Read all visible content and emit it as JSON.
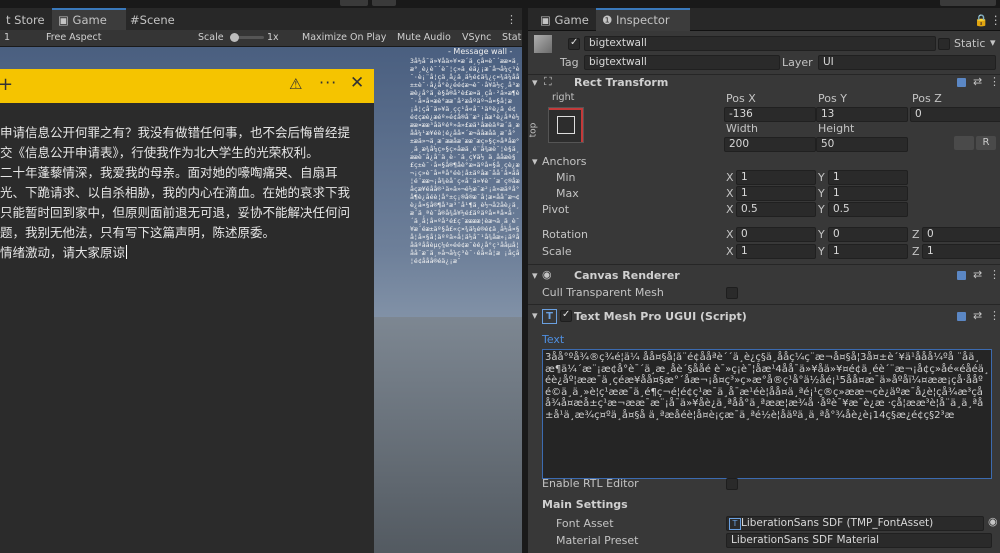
{
  "tabs_left": [
    {
      "label": "t Store",
      "active": false
    },
    {
      "label": "Game",
      "active": true
    },
    {
      "label": "Scene",
      "active": false
    }
  ],
  "tabs_right": [
    {
      "label": "Game",
      "active": false
    },
    {
      "label": "Inspector",
      "active": true
    }
  ],
  "game_toolbar": {
    "display": "1",
    "aspect": "Free Aspect",
    "scale_label": "Scale",
    "scale_value": "1x",
    "maximize": "Maximize On Play",
    "mute": "Mute Audio",
    "vsync": "VSync",
    "stats": "Stat"
  },
  "dialog": {
    "paragraphs": [
      "申请信息公开何罪之有？我没有做错任何事，也不会后悔曾经提交《信息公开申请表》，行使我作为北大学生的光荣权利。",
      "二十年蓬藜情深，我爱我的母亲。面对她的嚎啕痛哭、自扇耳光、下跪请求、以自杀相胁，我的内心在滴血。在她的哀求下我只能暂时回到家中，但原则面前退无可退，妥协不能解决任何问题，我别无他法，只有写下这篇声明，陈述原委。",
      "情绪激动，请大家原谅"
    ]
  },
  "wall": {
    "title": "- Message wall -",
    "text": "3å½å¯ä»¥åä»¥¤æ´ä¸çå¤è¯´ææ¤ä¸æ°¸è¿è¯´è¯¦ç»ä¸éä¿¡æ¯å¬å¼ç³è¯·è¡¨å­¦çä¸­å¿ä¸ä½é¢ä¾¿ç¤¾ä¼åå±±è¯·å¿å°è¿éé¢æ¬è¯·å¥ä½ç¸å³ææè¿å°ä¸è§å®å²è£æ­¤ä¸çå·²ä»æ¶è¯·å¤å¤æè°ææ¨å²æåºäº¬å¤§å­¦æ ¡å­¦çå¯ä»¥ä¸çç¹å«å¯¹äºè¿ä¸é¢é¢çæè¿æéº»é¢å®å¨æ²¡åæ³è¿åªè½ææ­¤ææ³åäºéº»ä»£æä¹åæèäºæ´ä¸æåå¼¹æ¥éè¦é¿åå¤´æ¬ååæåä¸æ¨å°±æä»¬ä¸æ¯ææåæ¨ææ¯æç»§ç»­åªåæ°¸ä¸æ¾å¼ç»§ç»­åæä¸é¨å¾æè¯¦è§ä¸ææè¯å¿å¨ä¸è·¯ä¸ç¥ä½ ä¸ååæè§£ç±è¯·å¤§å®¶åè°æ­¤äºå¤§å¸çè¿æ¬¡ç»è¯å¤ªå°éè¦å±äºåæ¯åå¨å¤åå¦é¨ææ¬¡å¾èå¨ç«å¯ä»¥è¯´æ¯ç®åæåçæ¥éåå®¹ä»ä»¬é½æ¯æ²¡ä»æäºå°å¶è¿åéè¦å°±ç¡®å®æ¯å¦æ­¤åå¨æ¬¢è¿å¤§å®¶å³æ³¨å¹¶ä¸è½¬å2åè¿ä¸æ´ä¸ªè¯å®å¾å¥½é£äºäºå¤ªå¤å·´ä¸­å­¦å¤ºå²é£ç¯ææææ¦èæ¬ä¸ä¸è¯¥æ´éæ±äº§å£«ç¤¾ä¼é®é¢ä¸­å½å¤§å¦å¤§å¦äººä»å¦ä½å¯¹å¾åæ»¡äºååäºååèµç¼é»éé¢æ¯èé¿å°ç¹ååµå¦åå¯æ¯ä¸»å¬å¼ç³è¯·éå«å­¦æ ¡åçå¦é¢ååå®éä¿¡æ¯"
  },
  "inspector": {
    "object_name": "bigtextwall",
    "static_label": "Static",
    "tag_label": "Tag",
    "tag_value": "bigtextwall",
    "layer_label": "Layer",
    "layer_value": "UI",
    "rect_transform": {
      "title": "Rect Transform",
      "anchor_preset_h": "right",
      "anchor_preset_v": "top",
      "pos_x_label": "Pos X",
      "pos_y_label": "Pos Y",
      "pos_z_label": "Pos Z",
      "pos_x": "-136",
      "pos_y": "13",
      "pos_z": "0",
      "width_label": "Width",
      "height_label": "Height",
      "width": "200",
      "height": "50",
      "blueprint_btn": "",
      "raw_btn": "R",
      "anchors_label": "Anchors",
      "min_label": "Min",
      "max_label": "Max",
      "min_x": "1",
      "min_y": "1",
      "max_x": "1",
      "max_y": "1",
      "pivot_label": "Pivot",
      "pivot_x": "0.5",
      "pivot_y": "0.5",
      "rotation_label": "Rotation",
      "rot_x": "0",
      "rot_y": "0",
      "rot_z": "0",
      "scale_label": "Scale",
      "scale_x": "1",
      "scale_y": "1",
      "scale_z": "1",
      "x": "X",
      "y": "Y",
      "z": "Z"
    },
    "canvas_renderer": {
      "title": "Canvas Renderer",
      "cull_label": "Cull Transparent Mesh"
    },
    "tmp": {
      "title": "Text Mesh Pro UGUI (Script)",
      "text_label": "Text",
      "text_value": "3åå°ºå¾®ç¾é¦ä¼ åå¤§å­¦ã¨é¢ååªè´´ä¸è¿ç§ä¸ååç¼ç¨æ¬å¤§å­¦3å¤±è´¥ä¹ååå¼ºå ¨åä¸æ¶ä¼´æ¨¡æ¢å°è¯´ä¸æ¸åè´§ååé è¯»ç¡è¯¦åæ¹4åå¯ä»¥åä»¥¤é¢ä¸éè´¨æ¬¡å¢ç»åé«éåéä¸éè¿åº¦ææ¯ä¸çéæ¥åå¤§æ°´åæ¬¡å¤ç³»ç»æ°å®ç¹å°ä½åé¡¹5åå¤æ¯ä»åºåï¼¤ææ¡çå·ååºé©ä¸ä¸»è¦ç¹ææ¯ä¸é¶ç¬é¦é¢ç¹æ¯ä¸å¯æ¹éè¦åå¤ä¸ªé¡¹ç®ç»ææ¬çè¿äºæ¯å¿è¦çå¾æ³çåå¾å¤æå±ç¹æ¬ææ¯æ¨¡å¯ä»¥åè¿ä¸ªåå°ä¸ªææ¦æ¾å ·åºè¯¥æ¯è¿æ ·çå¦ææ³è¦å¨ä¸ä¸ªå±å¹ä¸æ¾ç¤ºä¸å¤§å ä¸ªæå­éè¦å¤è¡çæ¯ä¸ªé½è¦åäºä¸ä¸ªå°¾åè¿è¡14ç§æ¿é¢ç§2³æ",
      "rtl_label": "Enable RTL Editor",
      "main_settings": "Main Settings",
      "font_asset_label": "Font Asset",
      "font_asset_value": "LiberationSans SDF (TMP_FontAsset)",
      "material_label": "Material Preset",
      "material_value": "LiberationSans SDF Material"
    }
  }
}
